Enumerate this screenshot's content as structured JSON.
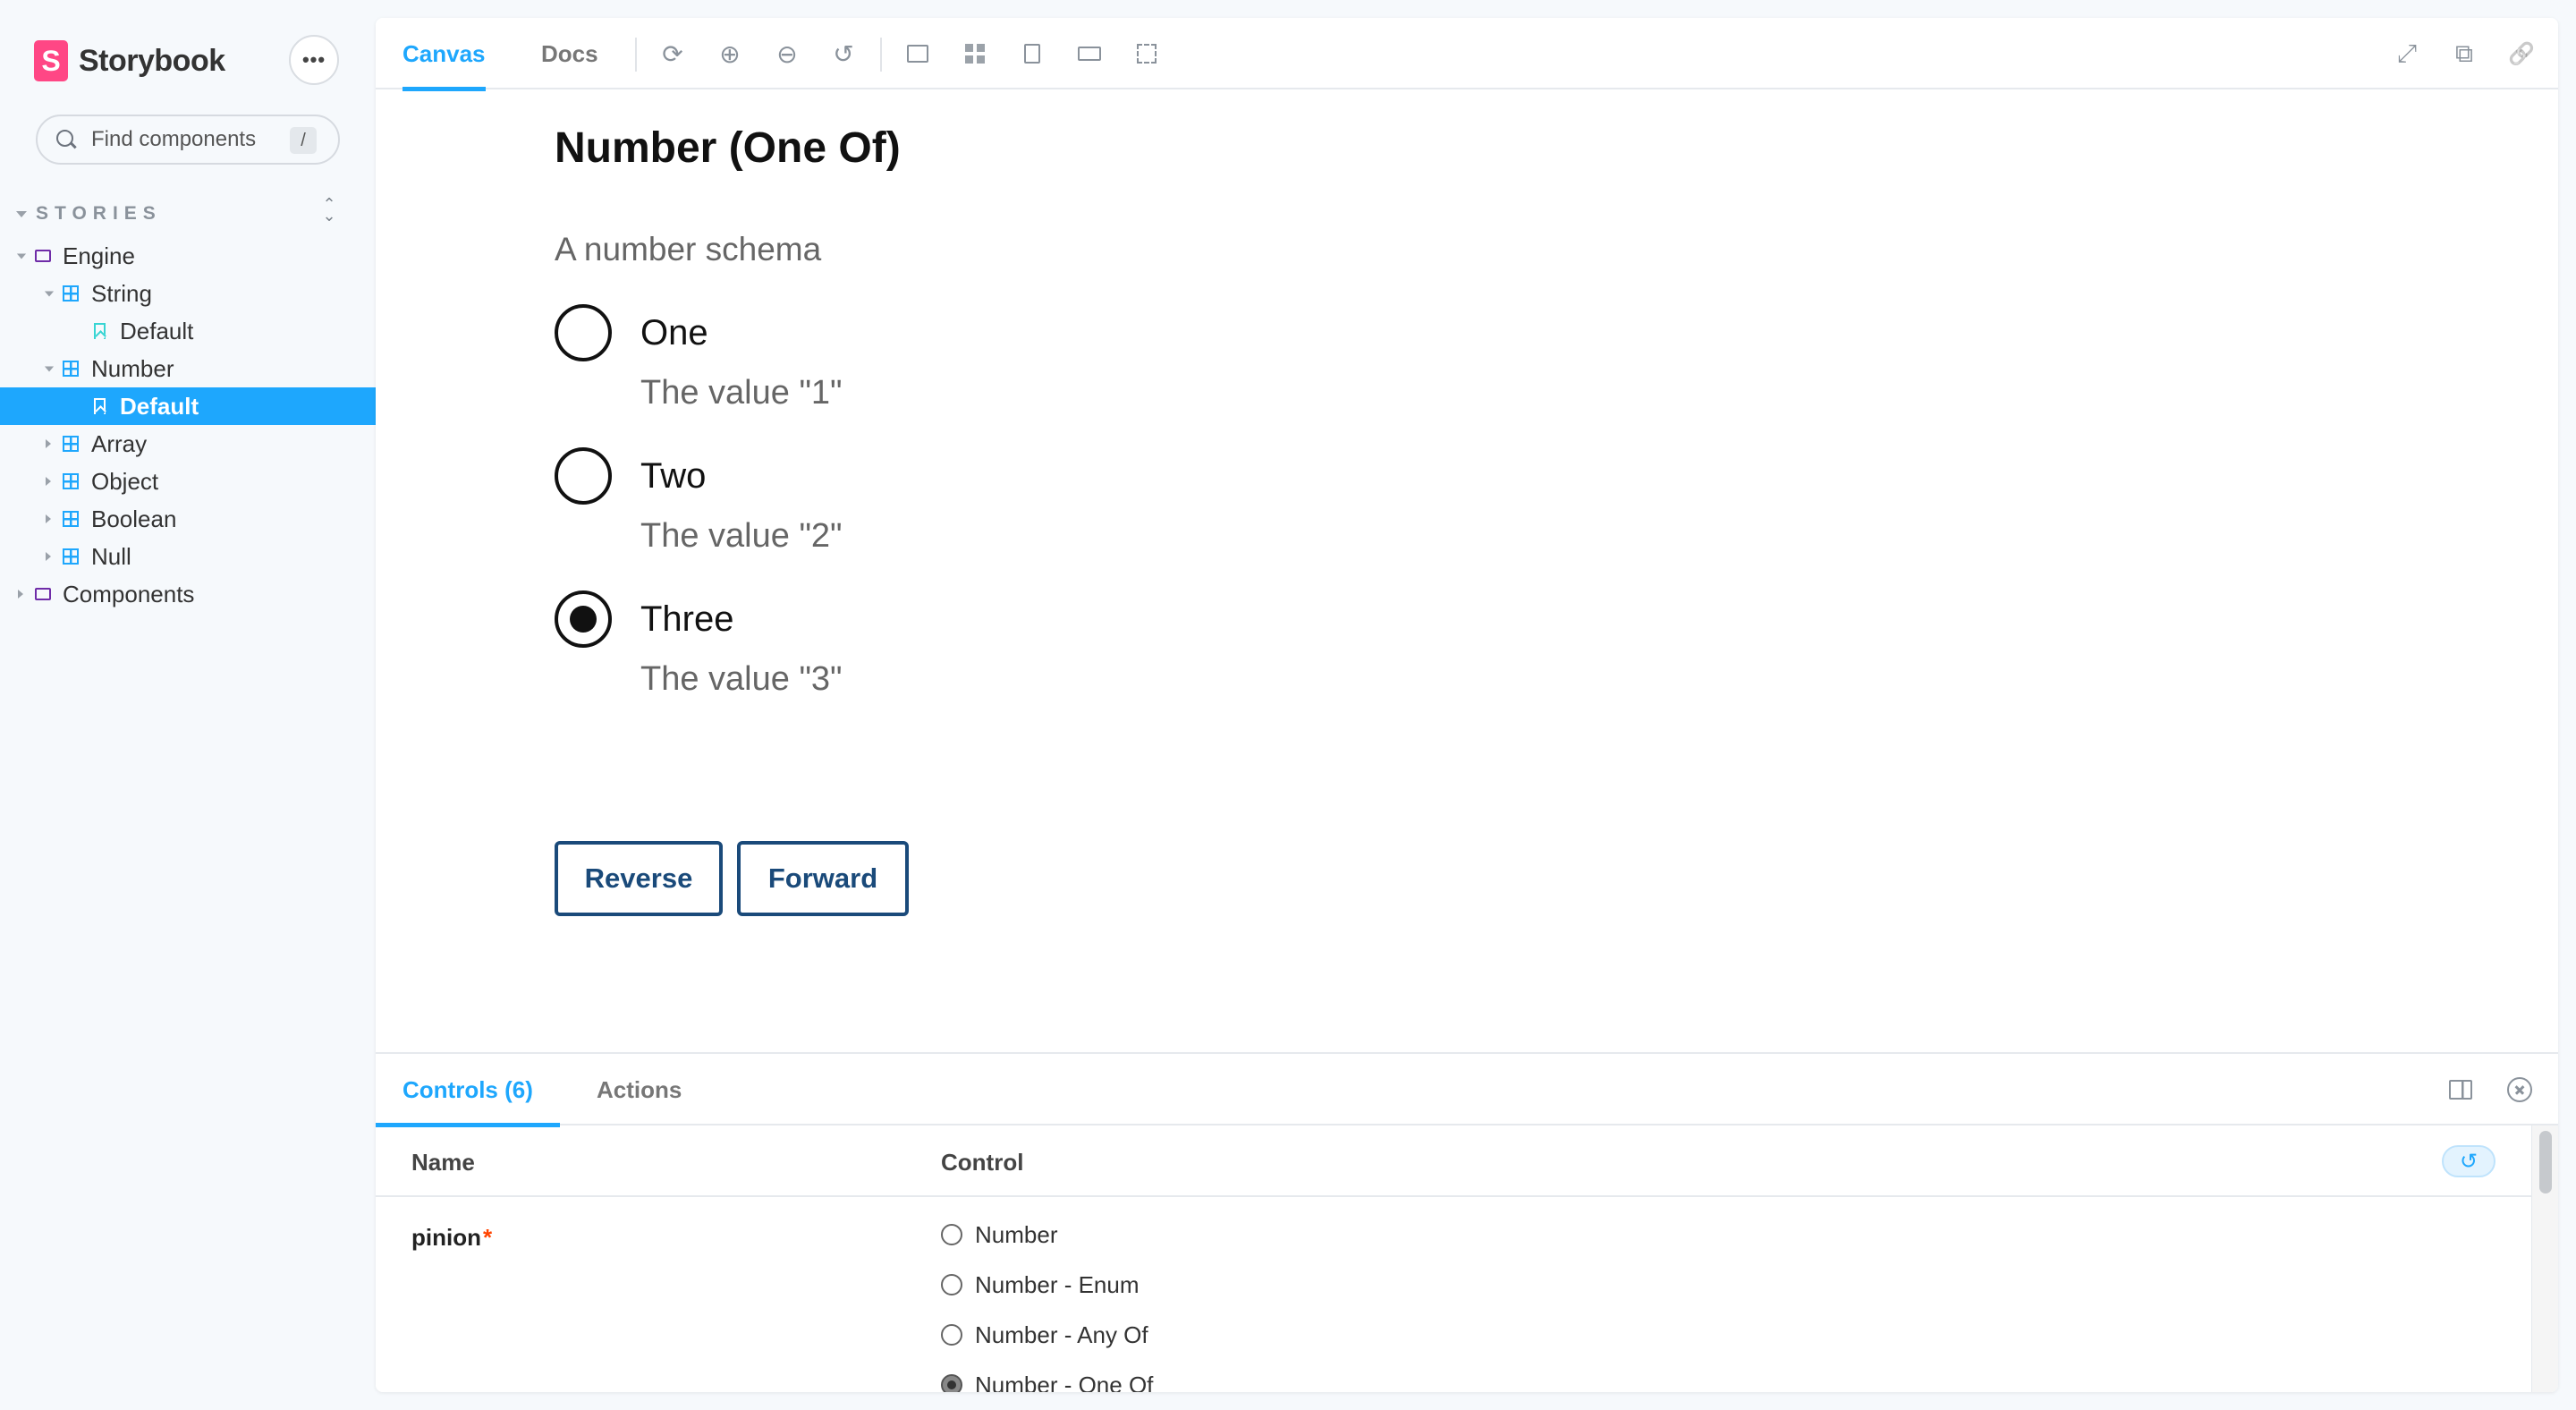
{
  "brand": {
    "logo_letter": "S",
    "name": "Storybook"
  },
  "sidebar": {
    "menu_label": "•••",
    "search": {
      "placeholder": "Find components",
      "shortcut": "/"
    },
    "section_title": "STORIES",
    "expand_icon": "⌃⌄",
    "tree": [
      {
        "label": "Engine",
        "type": "folder",
        "level": 0,
        "expanded": true
      },
      {
        "label": "String",
        "type": "component",
        "level": 1,
        "expanded": true
      },
      {
        "label": "Default",
        "type": "story",
        "level": 2
      },
      {
        "label": "Number",
        "type": "component",
        "level": 1,
        "expanded": true
      },
      {
        "label": "Default",
        "type": "story",
        "level": 2,
        "selected": true
      },
      {
        "label": "Array",
        "type": "component",
        "level": 1,
        "expanded": false
      },
      {
        "label": "Object",
        "type": "component",
        "level": 1,
        "expanded": false
      },
      {
        "label": "Boolean",
        "type": "component",
        "level": 1,
        "expanded": false
      },
      {
        "label": "Null",
        "type": "component",
        "level": 1,
        "expanded": false
      },
      {
        "label": "Components",
        "type": "folder",
        "level": 0,
        "expanded": false
      }
    ]
  },
  "toolbar": {
    "tabs": [
      {
        "label": "Canvas",
        "active": true
      },
      {
        "label": "Docs",
        "active": false
      }
    ],
    "icons": {
      "reload": "⟳",
      "zoom_in": "⊕",
      "zoom_out": "⊖",
      "zoom_reset": "↺",
      "fullscreen": "⤢",
      "open_new": "⧉",
      "link": "🔗"
    }
  },
  "story": {
    "title": "Number (One Of)",
    "description": "A number schema",
    "options": [
      {
        "label": "One",
        "description": "The value \"1\"",
        "checked": false
      },
      {
        "label": "Two",
        "description": "The value \"2\"",
        "checked": false
      },
      {
        "label": "Three",
        "description": "The value \"3\"",
        "checked": true
      }
    ],
    "reverse_label": "Reverse",
    "forward_label": "Forward"
  },
  "addons": {
    "tabs": [
      {
        "label": "Controls (6)",
        "active": true
      },
      {
        "label": "Actions",
        "active": false
      }
    ],
    "table": {
      "col_name": "Name",
      "col_control": "Control",
      "reset_icon": "↺",
      "rows": [
        {
          "name": "pinion",
          "required_mark": "*",
          "options": [
            {
              "label": "Number",
              "checked": false
            },
            {
              "label": "Number - Enum",
              "checked": false
            },
            {
              "label": "Number - Any Of",
              "checked": false
            },
            {
              "label": "Number - One Of",
              "checked": true
            }
          ]
        }
      ]
    }
  },
  "colors": {
    "accent": "#1ea7fd",
    "brand": "#ff4785",
    "button_border": "#1a4a7a",
    "required": "#ff4400"
  }
}
